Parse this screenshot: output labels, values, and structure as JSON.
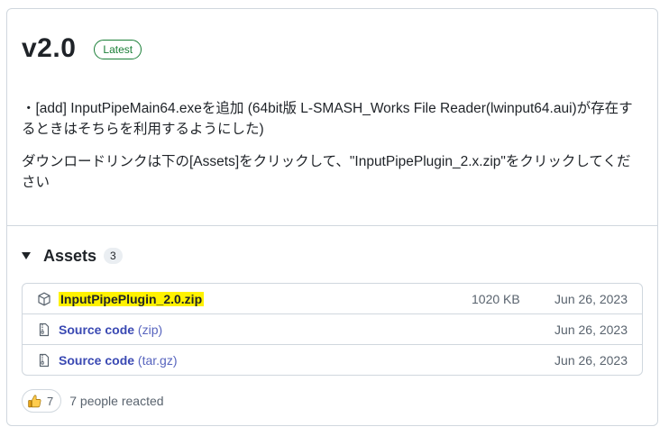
{
  "release": {
    "version": "v2.0",
    "badge": "Latest",
    "notes": [
      "・[add] InputPipeMain64.exeを追加 (64bit版 L-SMASH_Works File Reader(lwinput64.aui)が存在するときはそちらを利用するようにした)",
      "ダウンロードリンクは下の[Assets]をクリックして、\"InputPipePlugin_2.x.zip\"をクリックしてください"
    ]
  },
  "assets": {
    "title": "Assets",
    "count": "3",
    "items": [
      {
        "name": "InputPipePlugin_2.0.zip",
        "suffix": "",
        "size": "1020 KB",
        "date": "Jun 26, 2023",
        "icon": "package-icon"
      },
      {
        "name": "Source code",
        "suffix": "(zip)",
        "size": "",
        "date": "Jun 26, 2023",
        "icon": "file-zip-icon"
      },
      {
        "name": "Source code",
        "suffix": "(tar.gz)",
        "size": "",
        "date": "Jun 26, 2023",
        "icon": "file-zip-icon"
      }
    ]
  },
  "reactions": {
    "emoji": "thumbs-up-icon",
    "count": "7",
    "summary": "7 people reacted"
  },
  "colors": {
    "link": "#0969da",
    "latest_badge": "#1a7f37",
    "highlight": "#fff200",
    "border": "#d0d7de"
  }
}
